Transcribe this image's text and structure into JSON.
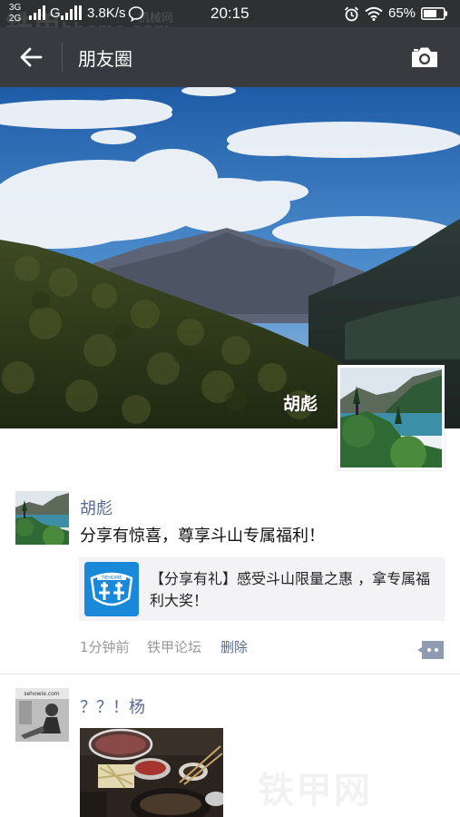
{
  "status_bar": {
    "net_top": "3G",
    "net_bottom": "2G",
    "network_type": "G",
    "speed": "3.8K/s",
    "time": "20:15",
    "battery": "65%"
  },
  "watermark": {
    "top_line": "铁甲",
    "top_mid": "机械网",
    "top_url": "hhome.com",
    "bottom": "铁甲网"
  },
  "nav": {
    "title": "朋友圈"
  },
  "cover": {
    "owner_name": "胡彪"
  },
  "posts": [
    {
      "name": "胡彪",
      "text": "分享有惊喜，尊享斗山专属福利！",
      "link": {
        "thumb_label": "TIEHOME",
        "title": "【分享有礼】感受斗山限量之惠 ，拿专属福利大奖！"
      },
      "time": "1分钟前",
      "source": "铁甲论坛",
      "delete_label": "删除"
    },
    {
      "name": "？？！杨",
      "avatar_caption": "sehowie.com"
    }
  ],
  "colors": {
    "status_bar": "#2e3132",
    "nav_bar": "#393a3f",
    "link_blue": "#576b95",
    "meta_gray": "#999999",
    "link_card_bg": "#f3f3f5",
    "thumb_blue": "#1a88d8"
  }
}
